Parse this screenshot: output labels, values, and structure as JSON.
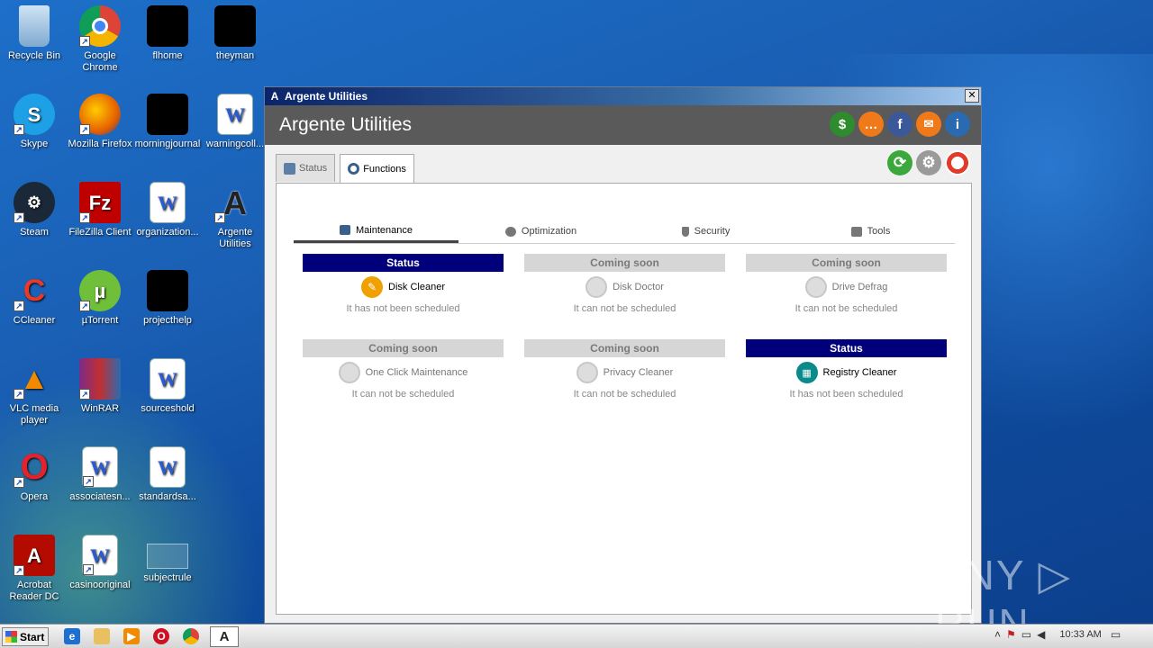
{
  "desktop": {
    "icons": [
      {
        "label": "Recycle Bin"
      },
      {
        "label": "Google Chrome"
      },
      {
        "label": "flhome"
      },
      {
        "label": "theyman"
      },
      {
        "label": "Skype"
      },
      {
        "label": "Mozilla Firefox"
      },
      {
        "label": "morningjournal"
      },
      {
        "label": "warningcoll..."
      },
      {
        "label": "Steam"
      },
      {
        "label": "FileZilla Client"
      },
      {
        "label": "organization..."
      },
      {
        "label": "Argente Utilities"
      },
      {
        "label": "CCleaner"
      },
      {
        "label": "µTorrent"
      },
      {
        "label": "projecthelp"
      },
      {
        "label": "VLC media player"
      },
      {
        "label": "WinRAR"
      },
      {
        "label": "sourceshold"
      },
      {
        "label": "Opera"
      },
      {
        "label": "associatesn..."
      },
      {
        "label": "standardsa..."
      },
      {
        "label": "Acrobat Reader DC"
      },
      {
        "label": "casinooriginal"
      },
      {
        "label": "subjectrule"
      }
    ]
  },
  "window": {
    "title": "Argente Utilities",
    "close_label": "✕",
    "header_title": "Argente Utilities",
    "tabs": [
      {
        "label": "Status"
      },
      {
        "label": "Functions"
      }
    ],
    "subtabs": [
      {
        "label": "Maintenance"
      },
      {
        "label": "Optimization"
      },
      {
        "label": "Security"
      },
      {
        "label": "Tools"
      }
    ],
    "cards": [
      {
        "header": "Status",
        "name": "Disk Cleaner",
        "schedule": "It has not been scheduled"
      },
      {
        "header": "Coming soon",
        "name": "Disk Doctor",
        "schedule": "It can not be scheduled"
      },
      {
        "header": "Coming soon",
        "name": "Drive Defrag",
        "schedule": "It can not be scheduled"
      },
      {
        "header": "Coming soon",
        "name": "One Click Maintenance",
        "schedule": "It can not be scheduled"
      },
      {
        "header": "Coming soon",
        "name": "Privacy Cleaner",
        "schedule": "It can not be scheduled"
      },
      {
        "header": "Status",
        "name": "Registry Cleaner",
        "schedule": "It has not been scheduled"
      }
    ]
  },
  "watermark": "ANY ▷ RUN",
  "taskbar": {
    "start_label": "Start",
    "clock": "10:33 AM"
  },
  "colors": {
    "status_header": "#00007a",
    "coming_soon_header": "#d6d6d6",
    "app_header": "#5a5a5a"
  }
}
